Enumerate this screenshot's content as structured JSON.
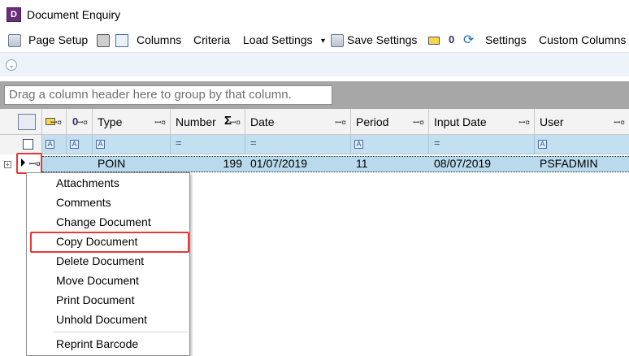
{
  "window": {
    "title": "Document Enquiry",
    "app_icon_letter": "D"
  },
  "toolbar": {
    "page_setup": "Page Setup",
    "columns": "Columns",
    "criteria": "Criteria",
    "load_settings": "Load Settings",
    "load_settings_arrow": "▾",
    "save_settings": "Save Settings",
    "zero_icon": "0",
    "settings": "Settings",
    "custom_columns": "Custom Columns"
  },
  "ribbon": {
    "expander_glyph": "⌄"
  },
  "group_panel": {
    "placeholder": "Drag a column header here to group by that column."
  },
  "grid": {
    "header_icons": {
      "zero": "0",
      "pin": "ꟷ¤"
    },
    "columns": [
      "Type",
      "Number",
      "Date",
      "Period",
      "Input Date",
      "User"
    ],
    "sum_glyph": "Σ",
    "row": {
      "type": "POIN",
      "number": "199",
      "date": "01/07/2019",
      "period": "11",
      "input_date": "08/07/2019",
      "user": "PSFADMIN"
    }
  },
  "context_menu": {
    "items": [
      "Attachments",
      "Comments",
      "Change Document",
      "Copy Document",
      "Delete Document",
      "Move Document",
      "Print Document",
      "Unhold Document",
      "Reprint Barcode"
    ],
    "highlighted": "Copy Document"
  },
  "colors": {
    "accent_red": "#e53935",
    "filter_row": "#c4dff0",
    "selected_row": "#b9d9ec"
  }
}
